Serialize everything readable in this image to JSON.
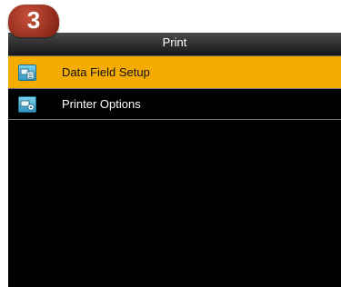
{
  "step_badge": "3",
  "header": {
    "title": "Print"
  },
  "menu": {
    "items": [
      {
        "label": "Data Field Setup",
        "icon": "data-field-setup-icon",
        "selected": true
      },
      {
        "label": "Printer Options",
        "icon": "printer-options-icon",
        "selected": false
      }
    ]
  },
  "colors": {
    "selection": "#f5ab00",
    "background": "#000000",
    "badge": "#a33a26"
  }
}
